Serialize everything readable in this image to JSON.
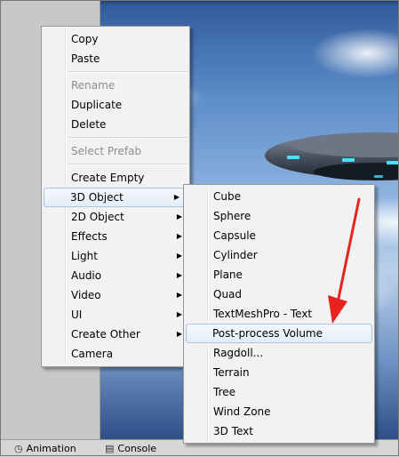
{
  "context_menu": {
    "groups": [
      [
        {
          "label": "Copy",
          "enabled": true
        },
        {
          "label": "Paste",
          "enabled": true
        }
      ],
      [
        {
          "label": "Rename",
          "enabled": false
        },
        {
          "label": "Duplicate",
          "enabled": true
        },
        {
          "label": "Delete",
          "enabled": true
        }
      ],
      [
        {
          "label": "Select Prefab",
          "enabled": false
        }
      ],
      [
        {
          "label": "Create Empty",
          "enabled": true,
          "submenu": false
        },
        {
          "label": "3D Object",
          "enabled": true,
          "submenu": true,
          "highlighted": true
        },
        {
          "label": "2D Object",
          "enabled": true,
          "submenu": true
        },
        {
          "label": "Effects",
          "enabled": true,
          "submenu": true
        },
        {
          "label": "Light",
          "enabled": true,
          "submenu": true
        },
        {
          "label": "Audio",
          "enabled": true,
          "submenu": true
        },
        {
          "label": "Video",
          "enabled": true,
          "submenu": true
        },
        {
          "label": "UI",
          "enabled": true,
          "submenu": true
        },
        {
          "label": "Create Other",
          "enabled": true,
          "submenu": true
        },
        {
          "label": "Camera",
          "enabled": true,
          "submenu": false
        }
      ]
    ]
  },
  "submenu_3d_object": {
    "items": [
      {
        "label": "Cube"
      },
      {
        "label": "Sphere"
      },
      {
        "label": "Capsule"
      },
      {
        "label": "Cylinder"
      },
      {
        "label": "Plane"
      },
      {
        "label": "Quad"
      },
      {
        "label": "TextMeshPro - Text"
      },
      {
        "label": "Post-process Volume",
        "highlighted": true
      },
      {
        "label": "Ragdoll..."
      },
      {
        "label": "Terrain"
      },
      {
        "label": "Tree"
      },
      {
        "label": "Wind Zone"
      },
      {
        "label": "3D Text"
      }
    ]
  },
  "bottom_tabs": [
    {
      "label": "Animation",
      "icon": "clock-icon"
    },
    {
      "label": "Console",
      "icon": "console-icon"
    }
  ],
  "colors": {
    "annotation_arrow": "#e8231f",
    "menu_highlight_border": "#a8c6e8"
  }
}
